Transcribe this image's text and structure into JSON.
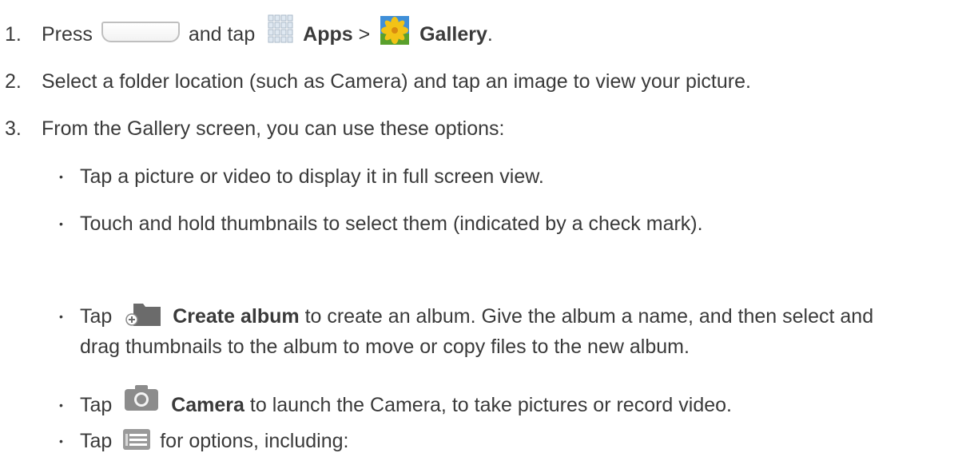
{
  "steps": [
    {
      "num": "1.",
      "pre": "Press",
      "mid": "and tap",
      "apps": "Apps",
      "sep": ">",
      "gallery": "Gallery",
      "end": "."
    },
    {
      "num": "2.",
      "text": "Select a folder location (such as Camera) and tap an image to view your picture."
    },
    {
      "num": "3.",
      "text": "From the Gallery screen, you can use these options:"
    }
  ],
  "bullets": [
    {
      "text": "Tap a picture or video to display it in full screen view."
    },
    {
      "text": "Touch and hold thumbnails to select them (indicated by a check mark)."
    },
    {
      "pre": "Tap",
      "bold": "Create album",
      "post": "to create an album. Give the album a name, and then select and",
      "line2": "drag thumbnails to the album to move or copy files to the new album."
    },
    {
      "pre": "Tap",
      "bold": "Camera",
      "post": "to launch the Camera, to take pictures or record video."
    },
    {
      "pre": "Tap",
      "post": "for options, including:"
    }
  ],
  "bullet_glyph": "•",
  "icons": [
    "home-button-icon",
    "apps-icon",
    "gallery-icon",
    "create-album-icon",
    "camera-icon",
    "menu-icon"
  ],
  "colors": {
    "text": "#3a3a3a",
    "folder": "#6b6b6b",
    "gallery_yellow": "#f2c316",
    "gallery_green": "#5aa02c",
    "gallery_blue": "#3f8fd8"
  }
}
